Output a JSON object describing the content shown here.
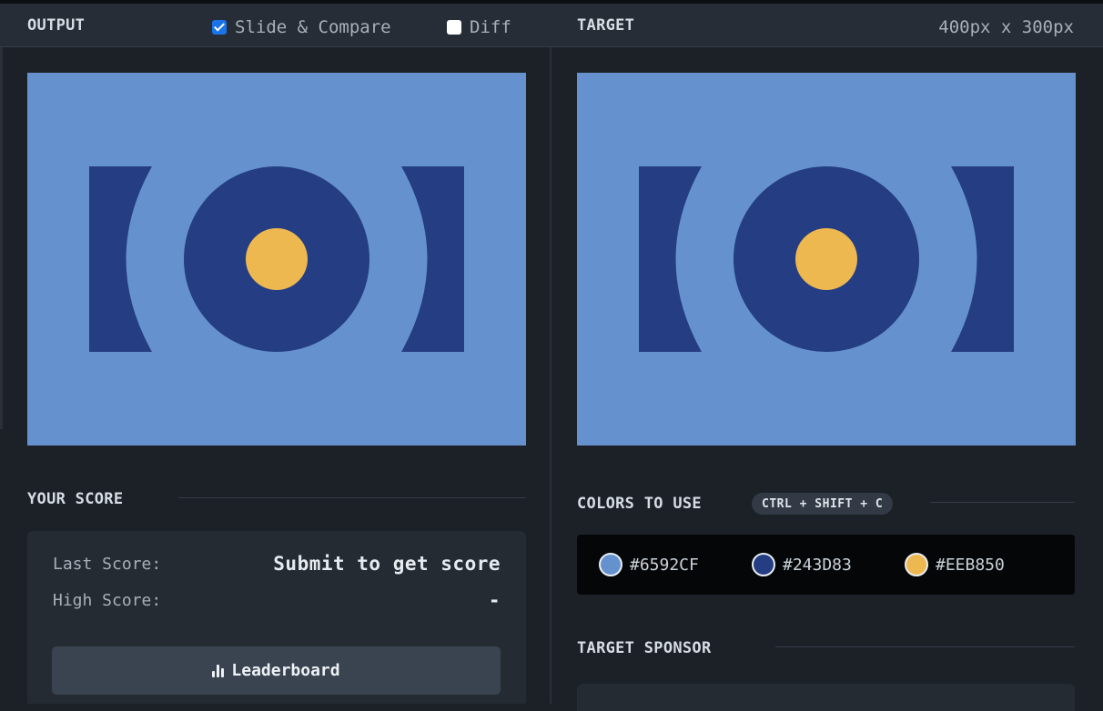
{
  "header": {
    "output_label": "OUTPUT",
    "slide_compare_label": "Slide & Compare",
    "slide_compare_checked": true,
    "diff_label": "Diff",
    "diff_checked": false,
    "target_label": "TARGET",
    "dimensions": "400px x 300px"
  },
  "canvas": {
    "background": "#6592CF",
    "shape_dark": "#243D83",
    "shape_accent": "#EEB850"
  },
  "score": {
    "title": "YOUR SCORE",
    "last_label": "Last Score:",
    "last_value": "Submit to get score",
    "high_label": "High Score:",
    "high_value": "-",
    "leaderboard_label": "Leaderboard",
    "leaderboard_icon": "bar-chart-icon"
  },
  "colors": {
    "title": "COLORS TO USE",
    "shortcut": "CTRL + SHIFT + C",
    "swatches": [
      {
        "hex": "#6592CF"
      },
      {
        "hex": "#243D83"
      },
      {
        "hex": "#EEB850"
      }
    ]
  },
  "sponsor": {
    "title": "TARGET SPONSOR"
  }
}
